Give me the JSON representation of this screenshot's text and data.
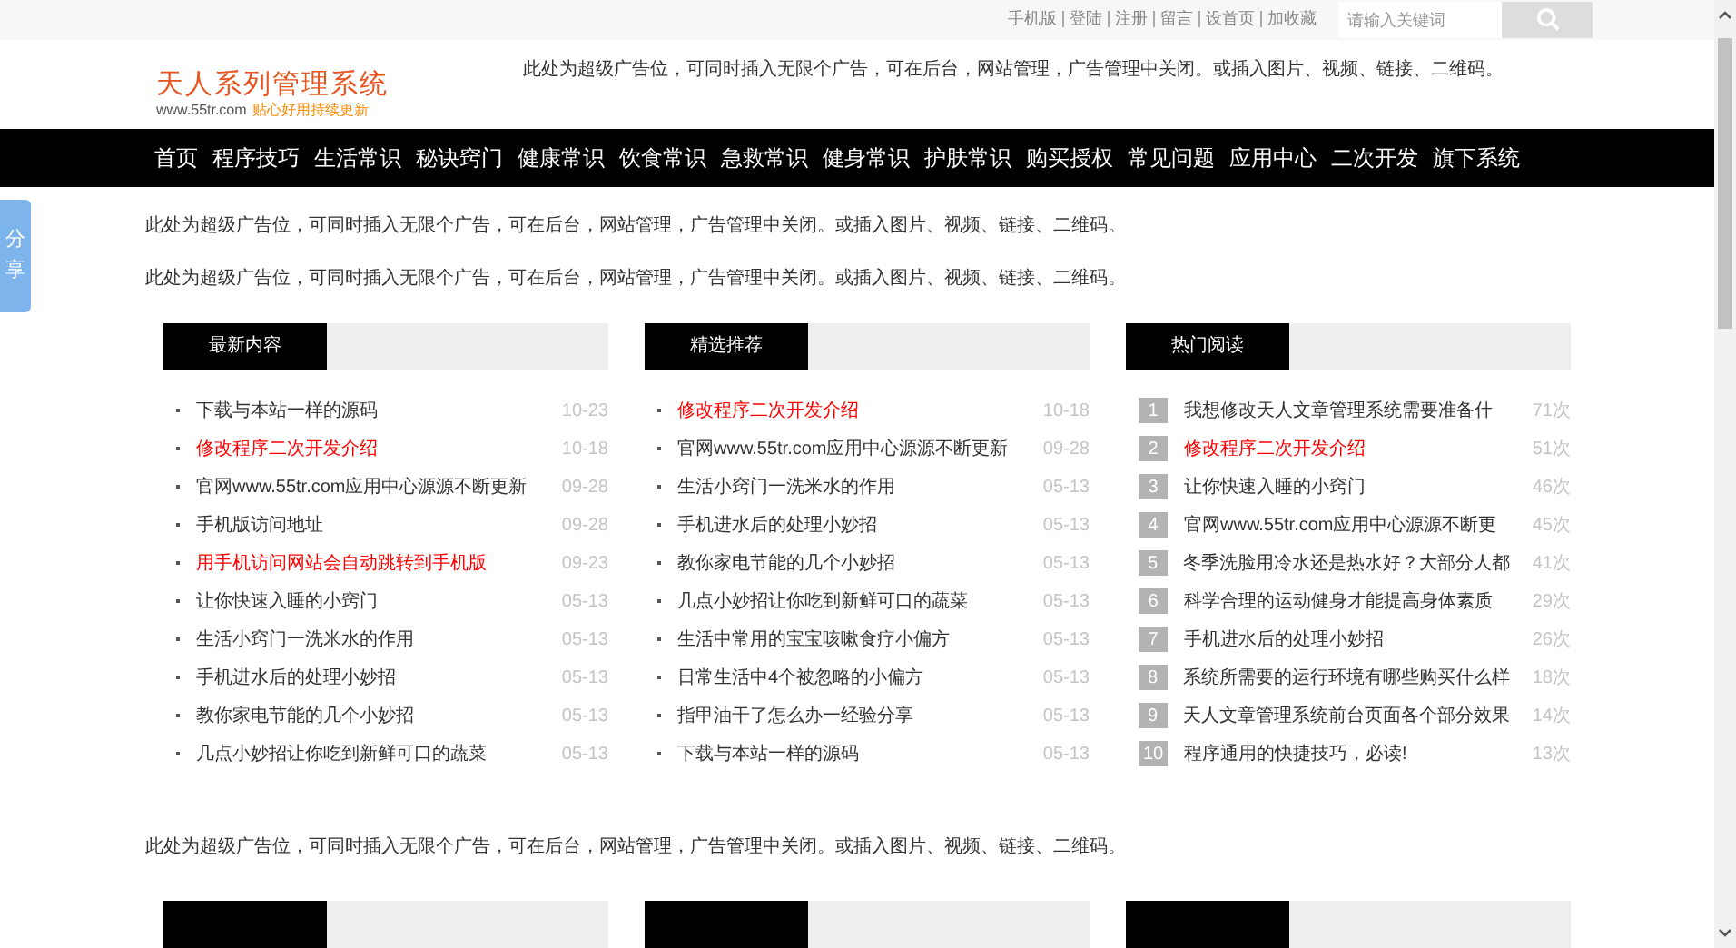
{
  "top_links": [
    "手机版",
    "登陆",
    "注册",
    "留言",
    "设首页",
    "加收藏"
  ],
  "search": {
    "placeholder": "请输入关键词"
  },
  "logo": {
    "title": "天人系列管理系统",
    "url": "www.55tr.com",
    "slogan": "贴心好用持续更新"
  },
  "header_ad": "此处为超级广告位，可同时插入无限个广告，可在后台，网站管理，广告管理中关闭。或插入图片、视频、链接、二维码。",
  "nav": [
    "首页",
    "程序技巧",
    "生活常识",
    "秘诀窍门",
    "健康常识",
    "饮食常识",
    "急救常识",
    "健身常识",
    "护肤常识",
    "购买授权",
    "常见问题",
    "应用中心",
    "二次开发",
    "旗下系统"
  ],
  "share": "分享",
  "ads_top": [
    "此处为超级广告位，可同时插入无限个广告，可在后台，网站管理，广告管理中关闭。或插入图片、视频、链接、二维码。",
    "此处为超级广告位，可同时插入无限个广告，可在后台，网站管理，广告管理中关闭。或插入图片、视频、链接、二维码。"
  ],
  "sections": [
    {
      "kind": "dated",
      "title": "最新内容",
      "items": [
        {
          "title": "下载与本站一样的源码",
          "meta": "10-23",
          "highlighted": false
        },
        {
          "title": "修改程序二次开发介绍",
          "meta": "10-18",
          "highlighted": true
        },
        {
          "title": "官网www.55tr.com应用中心源源不断更新",
          "meta": "09-28",
          "highlighted": false
        },
        {
          "title": "手机版访问地址",
          "meta": "09-28",
          "highlighted": false
        },
        {
          "title": "用手机访问网站会自动跳转到手机版",
          "meta": "09-23",
          "highlighted": true
        },
        {
          "title": "让你快速入睡的小窍门",
          "meta": "05-13",
          "highlighted": false
        },
        {
          "title": "生活小窍门一洗米水的作用",
          "meta": "05-13",
          "highlighted": false
        },
        {
          "title": "手机进水后的处理小妙招",
          "meta": "05-13",
          "highlighted": false
        },
        {
          "title": "教你家电节能的几个小妙招",
          "meta": "05-13",
          "highlighted": false
        },
        {
          "title": "几点小妙招让你吃到新鲜可口的蔬菜",
          "meta": "05-13",
          "highlighted": false
        }
      ]
    },
    {
      "kind": "dated",
      "title": "精选推荐",
      "items": [
        {
          "title": "修改程序二次开发介绍",
          "meta": "10-18",
          "highlighted": true
        },
        {
          "title": "官网www.55tr.com应用中心源源不断更新",
          "meta": "09-28",
          "highlighted": false
        },
        {
          "title": "生活小窍门一洗米水的作用",
          "meta": "05-13",
          "highlighted": false
        },
        {
          "title": "手机进水后的处理小妙招",
          "meta": "05-13",
          "highlighted": false
        },
        {
          "title": "教你家电节能的几个小妙招",
          "meta": "05-13",
          "highlighted": false
        },
        {
          "title": "几点小妙招让你吃到新鲜可口的蔬菜",
          "meta": "05-13",
          "highlighted": false
        },
        {
          "title": "生活中常用的宝宝咳嗽食疗小偏方",
          "meta": "05-13",
          "highlighted": false
        },
        {
          "title": "日常生活中4个被忽略的小偏方",
          "meta": "05-13",
          "highlighted": false
        },
        {
          "title": "指甲油干了怎么办一经验分享",
          "meta": "05-13",
          "highlighted": false
        },
        {
          "title": "下载与本站一样的源码",
          "meta": "05-13",
          "highlighted": false
        }
      ]
    },
    {
      "kind": "ranked",
      "title": "热门阅读",
      "items": [
        {
          "rank": "1",
          "title": "我想修改天人文章管理系统需要准备什",
          "meta": "71次",
          "highlighted": false
        },
        {
          "rank": "2",
          "title": "修改程序二次开发介绍",
          "meta": "51次",
          "highlighted": true
        },
        {
          "rank": "3",
          "title": "让你快速入睡的小窍门",
          "meta": "46次",
          "highlighted": false
        },
        {
          "rank": "4",
          "title": "官网www.55tr.com应用中心源源不断更",
          "meta": "45次",
          "highlighted": false
        },
        {
          "rank": "5",
          "title": "冬季洗脸用冷水还是热水好？大部分人都",
          "meta": "41次",
          "highlighted": false
        },
        {
          "rank": "6",
          "title": "科学合理的运动健身才能提高身体素质",
          "meta": "29次",
          "highlighted": false
        },
        {
          "rank": "7",
          "title": "手机进水后的处理小妙招",
          "meta": "26次",
          "highlighted": false
        },
        {
          "rank": "8",
          "title": "系统所需要的运行环境有哪些购买什么样",
          "meta": "18次",
          "highlighted": false
        },
        {
          "rank": "9",
          "title": "天人文章管理系统前台页面各个部分效果",
          "meta": "14次",
          "highlighted": false
        },
        {
          "rank": "10",
          "title": "程序通用的快捷技巧，必读!",
          "meta": "13次",
          "highlighted": false
        }
      ]
    }
  ],
  "ad_bottom": "此处为超级广告位，可同时插入无限个广告，可在后台，网站管理，广告管理中关闭。或插入图片、视频、链接、二维码。"
}
